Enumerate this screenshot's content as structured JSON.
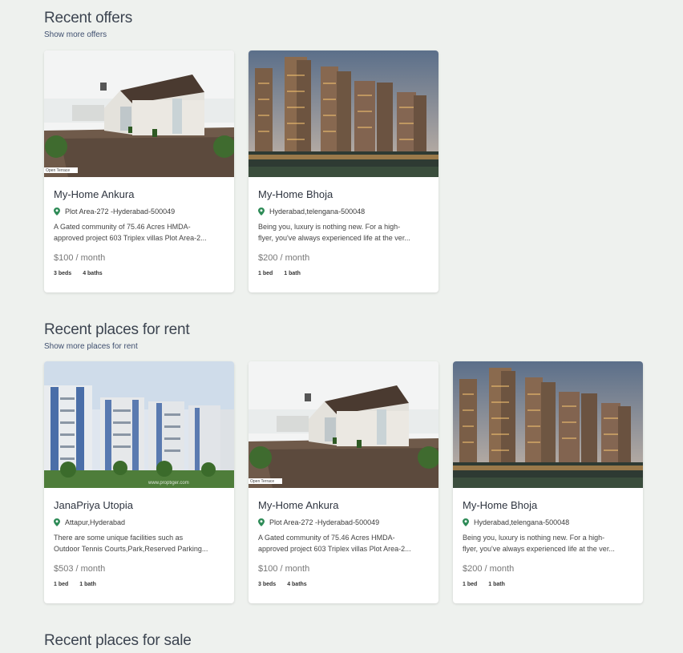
{
  "offers": {
    "title": "Recent offers",
    "more_link": "Show more offers",
    "cards": [
      {
        "title": "My-Home Ankura",
        "location": "Plot Area-272 -Hyderabad-500049",
        "desc_line1": "A Gated community of 75.46 Acres HMDA-",
        "desc_line2": "approved project 603 Triplex villas Plot Area-2...",
        "price": "$100 / month",
        "beds": "3 beds",
        "baths": "4 baths",
        "image": "villa-terrace"
      },
      {
        "title": "My-Home Bhoja",
        "location": "Hyderabad,telengana-500048",
        "desc_line1": "Being you, luxury is nothing new. For a high-",
        "desc_line2": "flyer, you've always experienced life at the ver...",
        "price": "$200 / month",
        "beds": "1 bed",
        "baths": "1 bath",
        "image": "towers-dusk"
      }
    ]
  },
  "rent": {
    "title": "Recent places for rent",
    "more_link": "Show more places for rent",
    "cards": [
      {
        "title": "JanaPriya Utopia",
        "location": "Attapur,Hyderabad",
        "desc_line1": "There are some unique facilities such as",
        "desc_line2": "Outdoor Tennis Courts,Park,Reserved Parking...",
        "price": "$503 / month",
        "beds": "1 bed",
        "baths": "1 bath",
        "image": "apartment-blocks"
      },
      {
        "title": "My-Home Ankura",
        "location": "Plot Area-272 -Hyderabad-500049",
        "desc_line1": "A Gated community of 75.46 Acres HMDA-",
        "desc_line2": "approved project 603 Triplex villas Plot Area-2...",
        "price": "$100 / month",
        "beds": "3 beds",
        "baths": "4 baths",
        "image": "villa-terrace"
      },
      {
        "title": "My-Home Bhoja",
        "location": "Hyderabad,telengana-500048",
        "desc_line1": "Being you, luxury is nothing new. For a high-",
        "desc_line2": "flyer, you've always experienced life at the ver...",
        "price": "$200 / month",
        "beds": "1 bed",
        "baths": "1 bath",
        "image": "towers-dusk"
      }
    ]
  },
  "sale": {
    "title": "Recent places for sale"
  },
  "image_texts": {
    "open_terrace": "Open Terrace",
    "watermark": "www.proptiger.com"
  },
  "colors": {
    "background": "#eef1ee",
    "pin": "#2e8b57"
  }
}
